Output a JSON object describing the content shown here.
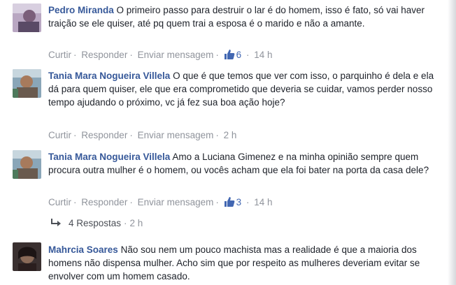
{
  "comments": [
    {
      "author": "Pedro Miranda",
      "text": "O primeiro passo para destruir o lar é do homem, isso é fato, só vai haver traição se ele quiser, até pq quem trai a esposa é o marido e não a amante.",
      "actions": [
        "Curtir",
        "Responder",
        "Enviar mensagem"
      ],
      "likes": "6",
      "time": "14 h"
    },
    {
      "author": "Tania Mara Nogueira Villela",
      "text": "O que é que temos que ver com isso, o parquinho é dela e ela dá para quem quiser, ele que era comprometido que deveria se cuidar, vamos perder nosso tempo ajudando o próximo, vc já fez sua boa ação hoje?",
      "actions": [
        "Curtir",
        "Responder",
        "Enviar mensagem"
      ],
      "likes": "",
      "time": "2 h"
    },
    {
      "author": "Tania Mara Nogueira Villela",
      "text": "Amo a Luciana Gimenez e na minha opinião sempre quem procura outra mulher é o homem, ou vocês acham que ela foi bater na porta da casa dele?",
      "actions": [
        "Curtir",
        "Responder",
        "Enviar mensagem"
      ],
      "likes": "3",
      "time": "14 h"
    },
    {
      "author": "Mahrcia Soares",
      "text": "Não sou nem um pouco machista mas a realidade é que a maioria dos homens não dispensa mulher. Acho sim que por respeito as mulheres deveriam evitar se envolver com um homem casado.",
      "actions": [],
      "likes": "",
      "time": ""
    }
  ],
  "replies": {
    "label": "4 Respostas",
    "time": "2 h"
  },
  "colors": {
    "author": "#365899",
    "meta": "#90949c",
    "like_blue": "#4267b2",
    "text": "#1d2129"
  },
  "icons": {
    "like": "thumbs-up-icon",
    "reply_arrow": "reply-arrow-icon"
  }
}
